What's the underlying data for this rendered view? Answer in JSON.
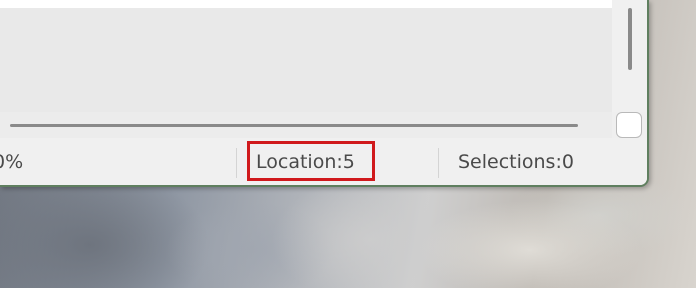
{
  "status_bar": {
    "zoom": "0%",
    "location": "Location:5",
    "selections": "Selections:0"
  },
  "highlight": {
    "target": "Location:5",
    "color": "#d0191c"
  },
  "colors": {
    "window_border": "#5f7f5f",
    "status_background": "#f0f0f0"
  }
}
